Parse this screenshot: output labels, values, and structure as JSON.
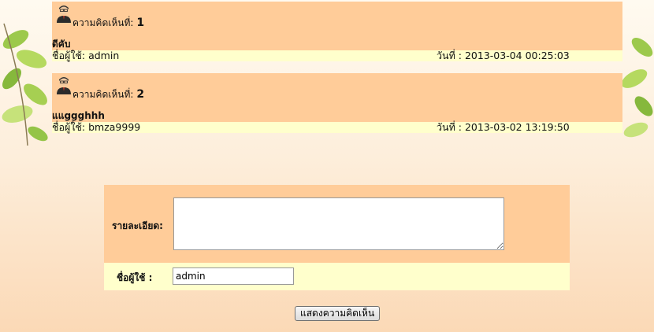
{
  "comments": [
    {
      "label": "ความคิดเห็นที่:",
      "number": "1",
      "text": "ดีคับ",
      "user": "ชื่อผู้ใช้: admin",
      "date": "วันที่ : 2013-03-04 00:25:03"
    },
    {
      "label": "ความคิดเห็นที่:",
      "number": "2",
      "text": "แแggghhh",
      "user": "ชื่อผู้ใช้: bmza9999",
      "date": "วันที่ : 2013-03-02 13:19:50"
    }
  ],
  "form": {
    "detail_label": "รายละเอียด:",
    "detail_value": "",
    "username_label": "ชื่อผู้ใช้ :",
    "username_value": "admin",
    "submit_label": "แสดงความคิดเห็น"
  },
  "colors": {
    "header_bg": "#ffcc99",
    "meta_bg": "#ffffcc"
  },
  "icons": [
    "user-avatar-icon",
    "leaves-decoration"
  ]
}
